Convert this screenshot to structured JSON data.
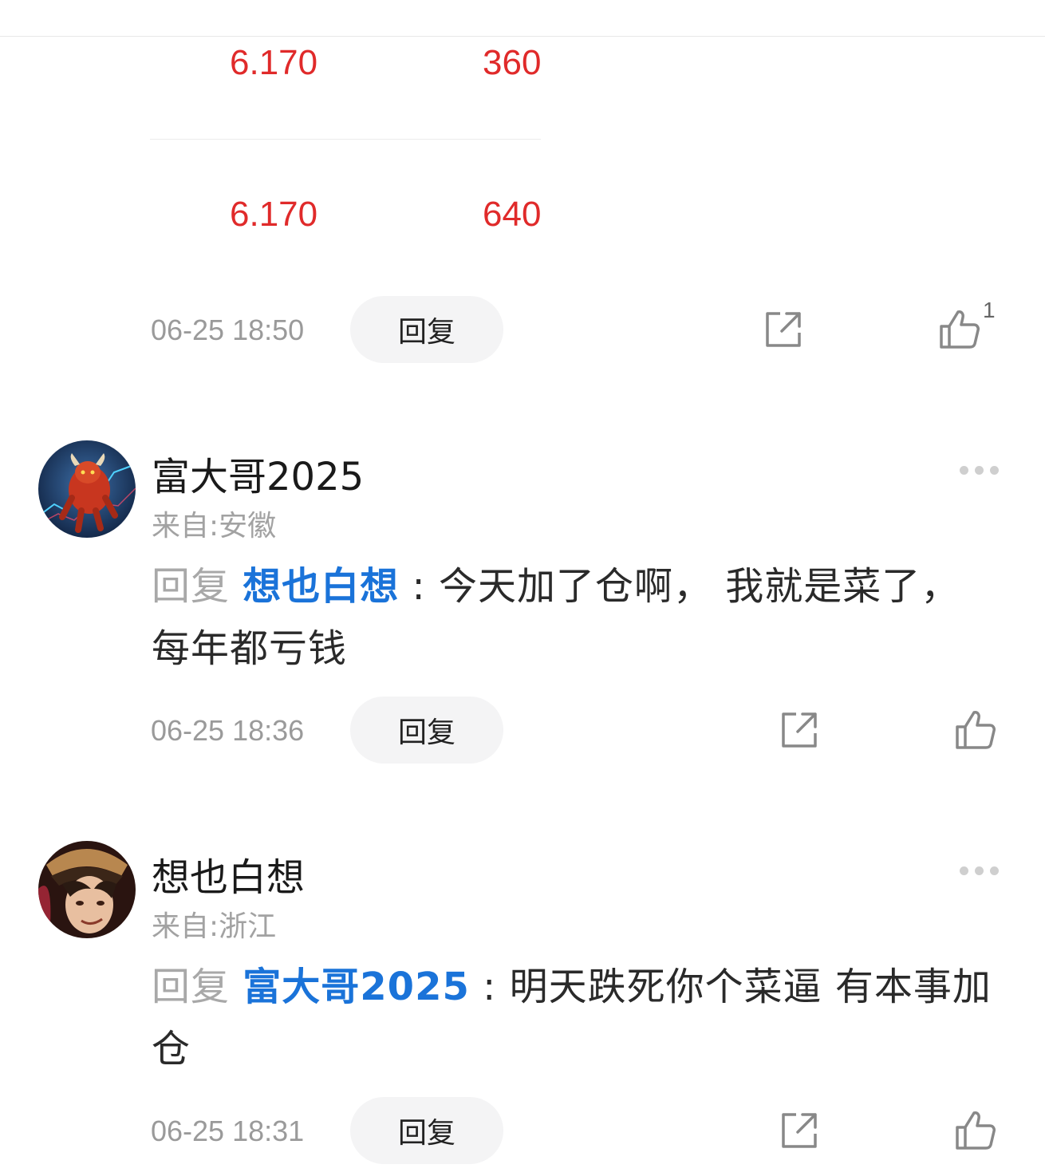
{
  "order_table": {
    "rows": [
      {
        "price": "6.170",
        "volume": "360"
      },
      {
        "price": "6.170",
        "volume": "640"
      }
    ]
  },
  "first_comment_footer": {
    "time": "06-25 18:50",
    "reply_label": "回复",
    "like_count": "1"
  },
  "comments": [
    {
      "username": "富大哥2025",
      "location": "来自:安徽",
      "reply_prefix": "回复",
      "mention": "想也白想",
      "separator": " : ",
      "text": "今天加了仓啊， 我就是菜了，每年都亏钱",
      "time": "06-25 18:36",
      "reply_label": "回复"
    },
    {
      "username": "想也白想",
      "location": "来自:浙江",
      "reply_prefix": "回复",
      "mention": "富大哥2025",
      "separator": " : ",
      "text": "明天跌死你个菜逼 有本事加仓",
      "time": "06-25 18:31",
      "reply_label": "回复"
    }
  ],
  "colors": {
    "price_red": "#e02a2a",
    "mention_blue": "#1a73d9",
    "muted_gray": "#9a9a9a"
  },
  "icons": [
    "share-icon",
    "thumbs-up-icon",
    "more-dots-icon"
  ]
}
